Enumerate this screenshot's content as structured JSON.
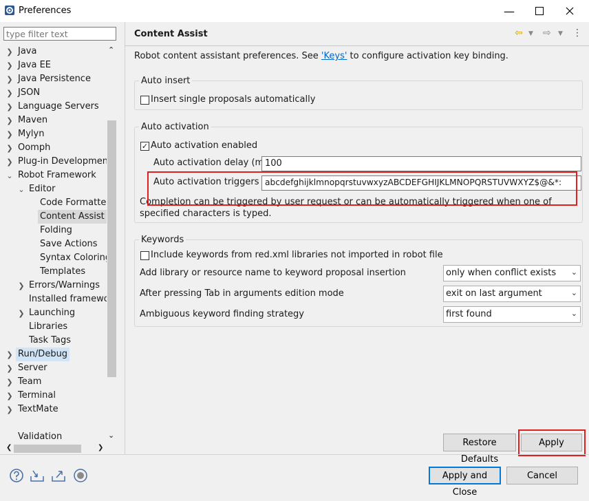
{
  "window": {
    "title": "Preferences"
  },
  "filter": {
    "placeholder": "type filter text"
  },
  "tree": [
    "Java",
    "Java EE",
    "Java Persistence",
    "JSON",
    "Language Servers",
    "Maven",
    "Mylyn",
    "Oomph",
    "Plug-in Development",
    "Robot Framework",
    "Editor",
    "Code Formatter",
    "Content Assist",
    "Folding",
    "Save Actions",
    "Syntax Coloring",
    "Templates",
    "Errors/Warnings",
    "Installed framework",
    "Launching",
    "Libraries",
    "Task Tags",
    "Run/Debug",
    "Server",
    "Team",
    "Terminal",
    "TextMate",
    "Validation"
  ],
  "page": {
    "title": "Content Assist",
    "desc_prefix": "Robot content assistant preferences. See ",
    "desc_link": "'Keys'",
    "desc_suffix": " to configure activation key binding."
  },
  "auto_insert": {
    "legend": "Auto insert",
    "single_label": "Insert single proposals automatically",
    "single_checked": false
  },
  "auto_activation": {
    "legend": "Auto activation",
    "enabled_label": "Auto activation enabled",
    "enabled_checked": true,
    "delay_label": "Auto activation delay (ms)",
    "delay_value": "100",
    "triggers_label": "Auto activation triggers",
    "triggers_value": "abcdefghijklmnopqrstuvwxyzABCDEFGHIJKLMNOPQRSTUVWXYZ$@&*:",
    "note": "Completion can be triggered by user request or can be automatically triggered when one of specified characters is typed."
  },
  "keywords": {
    "legend": "Keywords",
    "include_label": "Include keywords from red.xml libraries not imported in robot file",
    "include_checked": false,
    "add_label": "Add library or resource name to keyword proposal insertion",
    "add_value": "only when conflict exists",
    "tab_label": "After pressing Tab in arguments edition mode",
    "tab_value": "exit on last argument",
    "ambig_label": "Ambiguous keyword finding strategy",
    "ambig_value": "first found"
  },
  "buttons": {
    "restore": "Restore Defaults",
    "apply": "Apply",
    "apply_close": "Apply and Close",
    "cancel": "Cancel"
  },
  "colors": {
    "highlight": "#e02020",
    "link": "#0066cc"
  }
}
